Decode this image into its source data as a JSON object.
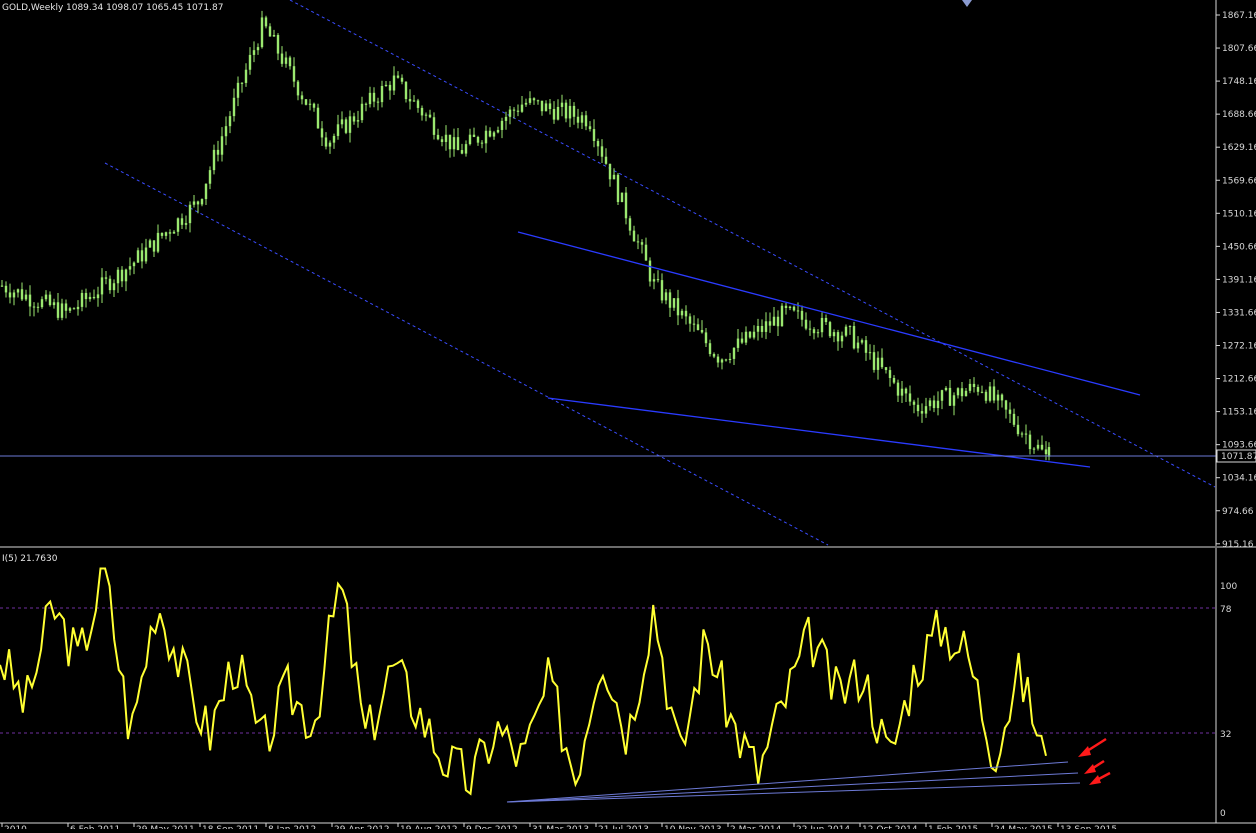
{
  "main_chart": {
    "symbol": "GOLD,Weekly",
    "ohlc_values": "1089.34 1098.07 1065.45 1071.87",
    "current_price": "1071.87",
    "price_levels": [
      "1867.16",
      "1807.66",
      "1748.16",
      "1688.66",
      "1629.16",
      "1569.66",
      "1510.16",
      "1450.66",
      "1391.16",
      "1331.66",
      "1272.16",
      "1212.66",
      "1153.16",
      "1093.66",
      "1034.16",
      "974.66",
      "915.16"
    ],
    "colors": {
      "background": "#000000",
      "candles": "#9be870",
      "trendlines": "#2a3bff",
      "channel": "#3a4cff",
      "price_line": "#6d7ad6",
      "text": "#e6e6e6"
    }
  },
  "indicator": {
    "title": "I(5) 21.7630",
    "levels": [
      "100",
      "78",
      "32",
      "0"
    ],
    "line_color": "#ffff33",
    "level_line_color": "#7030a0",
    "arrow_color": "#ff1a1a"
  },
  "x_axis": {
    "labels": [
      "2010",
      "6 Feb 2011",
      "29 May 2011",
      "18 Sep 2011",
      "8 Jan 2012",
      "29 Apr 2012",
      "19 Aug 2012",
      "9 Dec 2012",
      "31 Mar 2013",
      "21 Jul 2013",
      "10 Nov 2013",
      "2 Mar 2014",
      "22 Jun 2014",
      "12 Oct 2014",
      "1 Feb 2015",
      "24 May 2015",
      "13 Sep 2015"
    ]
  },
  "chart_data": [
    {
      "type": "candlestick",
      "title": "GOLD,Weekly",
      "ylim": [
        915.16,
        1867.16
      ],
      "x": [
        "2010",
        "6 Feb 2011",
        "29 May 2011",
        "18 Sep 2011",
        "8 Jan 2012",
        "29 Apr 2012",
        "19 Aug 2012",
        "9 Dec 2012",
        "31 Mar 2013",
        "21 Jul 2013",
        "10 Nov 2013",
        "2 Mar 2014",
        "22 Jun 2014",
        "12 Oct 2014",
        "1 Feb 2015",
        "24 May 2015",
        "13 Sep 2015"
      ],
      "series": [
        {
          "values": [
            1380,
            1330,
            1420,
            1530,
            1850,
            1640,
            1750,
            1620,
            1710,
            1680,
            1380,
            1250,
            1330,
            1290,
            1160,
            1200,
            1072
          ]
        }
      ],
      "last_bar": {
        "open": 1089.34,
        "high": 1098.07,
        "low": 1065.45,
        "close": 1071.87
      }
    },
    {
      "type": "line",
      "title": "I(5) 21.7630",
      "ylim": [
        0,
        100
      ],
      "levels": [
        78,
        32
      ],
      "last_value": 21.763,
      "series": [
        {
          "values": [
            62,
            42,
            82,
            60,
            96,
            30,
            85,
            55,
            30,
            62,
            25,
            48,
            35,
            92,
            28,
            58,
            40,
            20,
            12,
            33,
            20,
            52,
            14,
            65,
            30,
            83,
            20,
            70,
            35,
            15,
            44,
            70,
            46,
            56,
            20,
            57,
            74,
            63,
            23,
            55,
            22
          ]
        }
      ]
    }
  ]
}
